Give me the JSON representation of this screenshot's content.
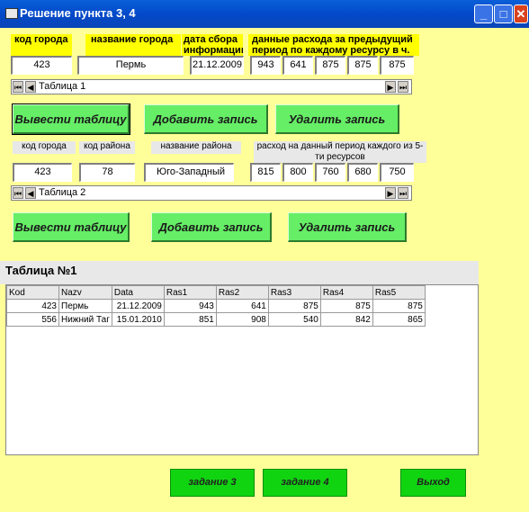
{
  "window": {
    "title": "Решение пункта 3, 4",
    "minimize": "_",
    "maximize": "□",
    "close": "✕"
  },
  "form1": {
    "labels": {
      "kod": "код города",
      "city": "название города",
      "date": "дата сбора информации",
      "rashod": "данные расхода за предыдущий период по каждому ресурсу в ч."
    },
    "values": {
      "kod": "423",
      "city": "Пермь",
      "date": "21.12.2009",
      "r1": "943",
      "r2": "641",
      "r3": "875",
      "r4": "875",
      "r5": "875"
    },
    "nav_caption": "Таблица 1",
    "buttons": {
      "show": "Вывести таблицу",
      "add": "Добавить запись",
      "delete": "Удалить запись"
    }
  },
  "form2": {
    "labels": {
      "kod": "код города",
      "kod_rayona": "код района",
      "name": "название района",
      "rashod": "расход на данный период каждого из 5-ти ресурсов"
    },
    "values": {
      "kod": "423",
      "kod_rayona": "78",
      "name": "Юго-Западный",
      "r1": "815",
      "r2": "800",
      "r3": "760",
      "r4": "680",
      "r5": "750"
    },
    "nav_caption": "Таблица 2",
    "buttons": {
      "show": "Вывести таблицу",
      "add": "Добавить запись",
      "delete": "Удалить запись"
    }
  },
  "nav_icons": {
    "first": "⏮",
    "prev": "◀",
    "next": "▶",
    "last": "⏭"
  },
  "grid": {
    "title": "Таблица №1",
    "columns": [
      "Kod",
      "Nazv",
      "Data",
      "Ras1",
      "Ras2",
      "Ras3",
      "Ras4",
      "Ras5"
    ],
    "rows": [
      [
        "423",
        "Пермь",
        "21.12.2009",
        "943",
        "641",
        "875",
        "875",
        "875"
      ],
      [
        "556",
        "Нижний Таг",
        "15.01.2010",
        "851",
        "908",
        "540",
        "842",
        "865"
      ]
    ]
  },
  "bottom_buttons": {
    "task3": "задание 3",
    "task4": "задание 4",
    "exit": "Выход"
  }
}
